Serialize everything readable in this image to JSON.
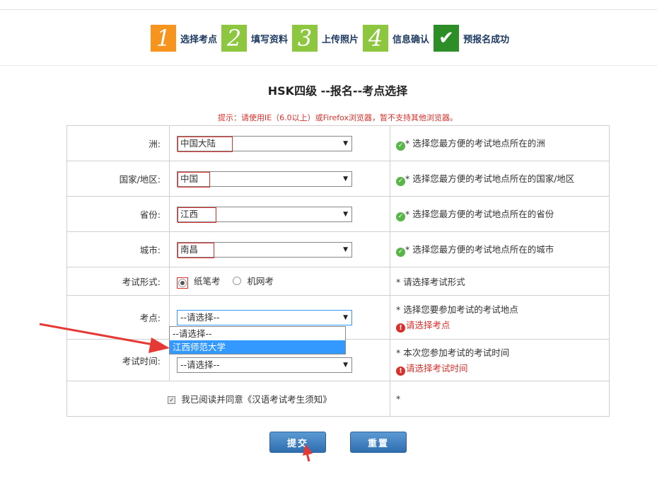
{
  "steps": [
    {
      "num": "1",
      "label": "选择考点"
    },
    {
      "num": "2",
      "label": "填写资料"
    },
    {
      "num": "3",
      "label": "上传照片"
    },
    {
      "num": "4",
      "label": "信息确认"
    },
    {
      "num": "✔",
      "label": "预报名成功"
    }
  ],
  "page_title": "HSK四级 --报名--考点选择",
  "notice": "提示：请使用IE（6.0以上）或Firefox浏览器，暂不支持其他浏览器。",
  "form": {
    "continent": {
      "label": "洲:",
      "value": "中国大陆",
      "hint": "* 选择您最方便的考试地点所在的洲"
    },
    "country": {
      "label": "国家/地区:",
      "value": "中国",
      "hint": "* 选择您最方便的考试地点所在的国家/地区"
    },
    "province": {
      "label": "省份:",
      "value": "江西",
      "hint": "* 选择您最方便的考试地点所在的省份"
    },
    "city": {
      "label": "城市:",
      "value": "南昌",
      "hint": "* 选择您最方便的考试地点所在的城市"
    },
    "exam_form": {
      "label": "考试形式:",
      "options": [
        "纸笔考",
        "机网考"
      ],
      "selected": "纸笔考",
      "hint": "* 请选择考试形式"
    },
    "test_center": {
      "label": "考点:",
      "value": "--请选择--",
      "hint": "* 选择您要参加考试的考试地点",
      "error": "请选择考点",
      "options": [
        "--请选择--",
        "江西师范大学"
      ],
      "highlighted": "江西师范大学"
    },
    "exam_time": {
      "label": "考试时间:",
      "value": "--请选择--",
      "hint": "* 本次您参加考试的考试时间",
      "error": "请选择考试时间"
    },
    "agree": {
      "label": "我已阅读并同意《汉语考试考生须知》",
      "checked": true,
      "hint": "*"
    }
  },
  "buttons": {
    "submit": "提交",
    "reset": "重置"
  },
  "colors": {
    "accent_red": "#d9302b",
    "button_blue": "#3b7cc0",
    "highlight": "#3399ff"
  }
}
